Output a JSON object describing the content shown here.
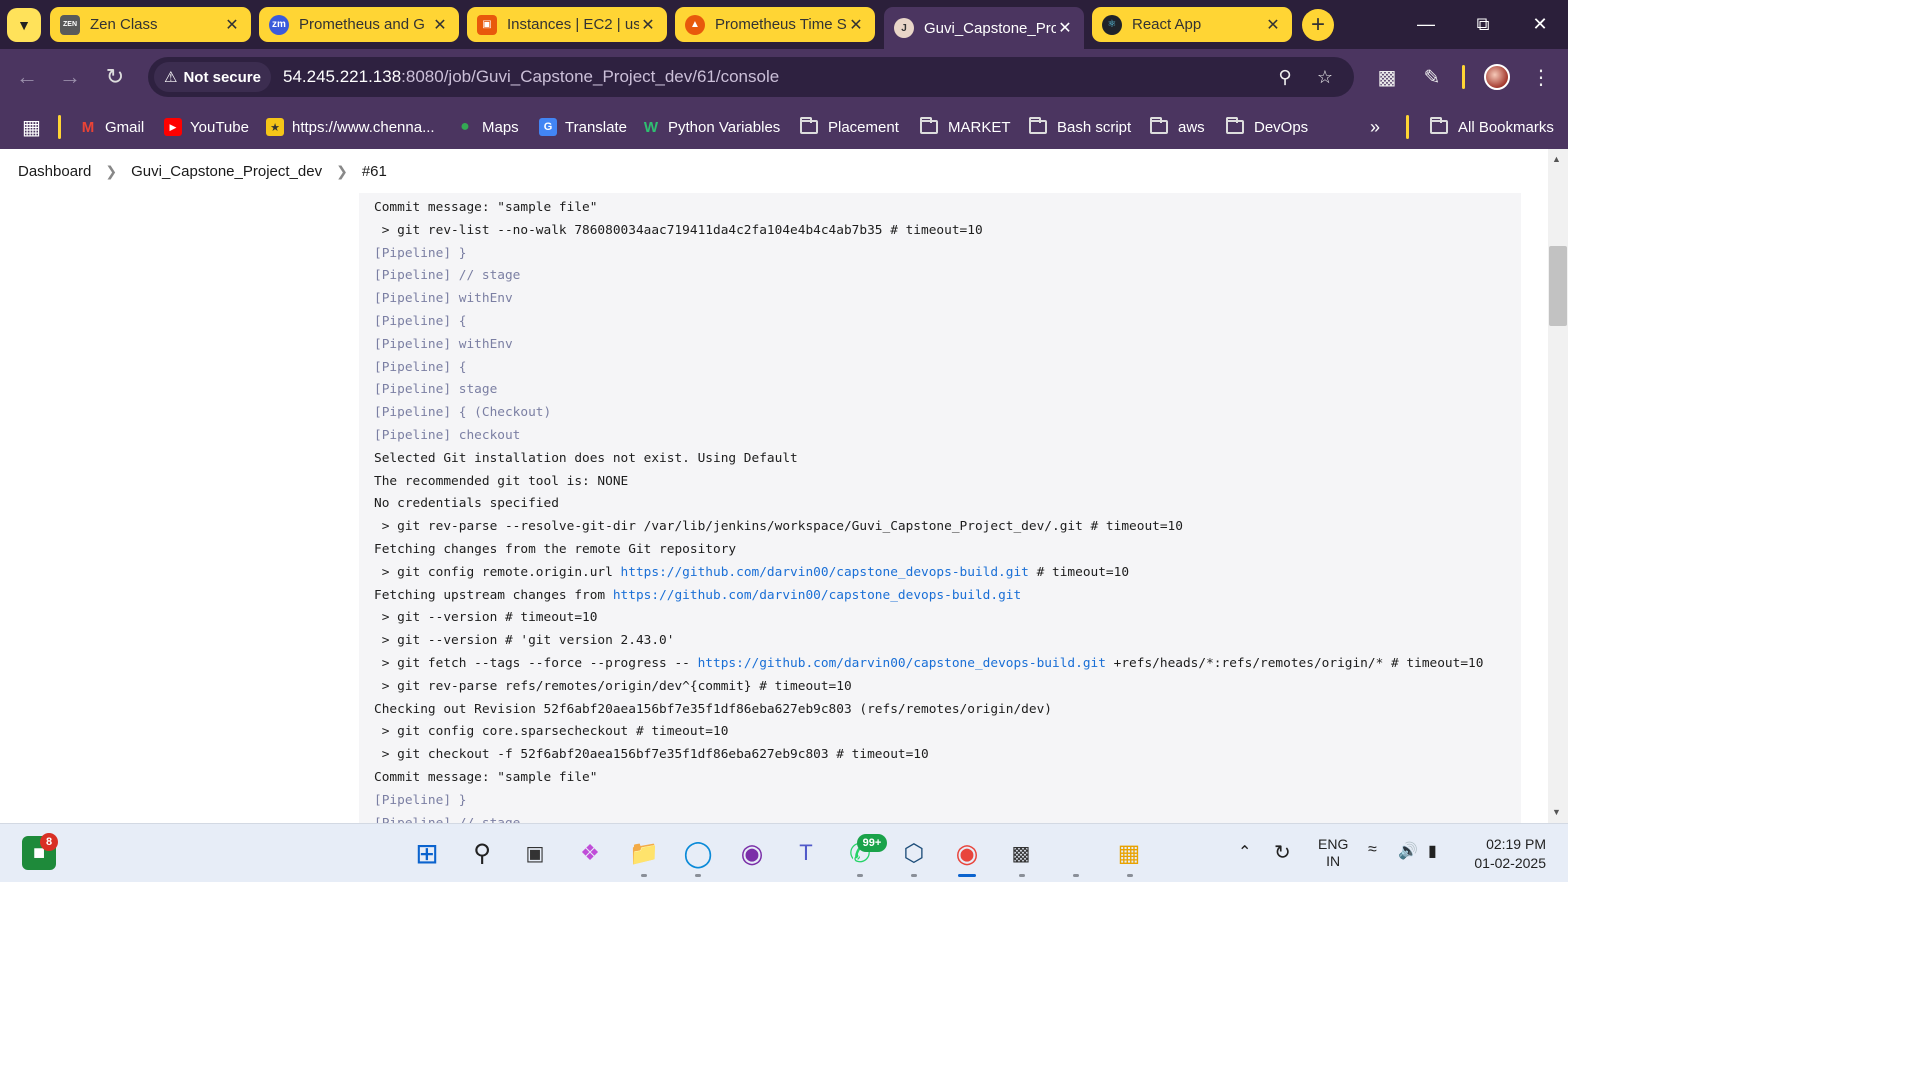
{
  "tabs": [
    {
      "title": "Zen Class",
      "icon": "zen-class-favicon"
    },
    {
      "title": "Prometheus and G",
      "icon": "zoom-favicon"
    },
    {
      "title": "Instances | EC2 | us",
      "icon": "aws-favicon"
    },
    {
      "title": "Prometheus Time S",
      "icon": "prometheus-favicon"
    },
    {
      "title": "Guvi_Capstone_Pro",
      "icon": "jenkins-favicon",
      "active": true
    },
    {
      "title": "React App",
      "icon": "react-favicon"
    }
  ],
  "omnibox": {
    "security_label": "Not secure",
    "url_host": "54.245.221.138",
    "url_rest": ":8080/job/Guvi_Capstone_Project_dev/61/console"
  },
  "bookmarks": {
    "gmail": "Gmail",
    "youtube": "YouTube",
    "chennai": "https://www.chenna...",
    "maps": "Maps",
    "translate": "Translate",
    "python": "Python Variables",
    "placement": "Placement",
    "market": "MARKET",
    "bash": "Bash script",
    "aws": "aws",
    "devops": "DevOps",
    "all": "All Bookmarks"
  },
  "breadcrumb": {
    "dashboard": "Dashboard",
    "job": "Guvi_Capstone_Project_dev",
    "build": "#61"
  },
  "console": {
    "lines": [
      {
        "text": "Commit message: \"sample file\"",
        "kind": "plain"
      },
      {
        "text": " > git rev-list --no-walk 786080034aac719411da4c2fa104e4b4c4ab7b35 # timeout=10",
        "kind": "plain"
      },
      {
        "text": "[Pipeline] }",
        "kind": "pipe"
      },
      {
        "text": "[Pipeline] // stage",
        "kind": "pipe"
      },
      {
        "text": "[Pipeline] withEnv",
        "kind": "pipe"
      },
      {
        "text": "[Pipeline] {",
        "kind": "pipe"
      },
      {
        "text": "[Pipeline] withEnv",
        "kind": "pipe"
      },
      {
        "text": "[Pipeline] {",
        "kind": "pipe"
      },
      {
        "text": "[Pipeline] stage",
        "kind": "pipe"
      },
      {
        "text": "[Pipeline] { (Checkout)",
        "kind": "pipe"
      },
      {
        "text": "[Pipeline] checkout",
        "kind": "pipe"
      },
      {
        "text": "Selected Git installation does not exist. Using Default",
        "kind": "plain"
      },
      {
        "text": "The recommended git tool is: NONE",
        "kind": "plain"
      },
      {
        "text": "No credentials specified",
        "kind": "plain"
      },
      {
        "text": " > git rev-parse --resolve-git-dir /var/lib/jenkins/workspace/Guvi_Capstone_Project_dev/.git # timeout=10",
        "kind": "plain"
      },
      {
        "text": "Fetching changes from the remote Git repository",
        "kind": "plain"
      },
      {
        "pre": " > git config remote.origin.url ",
        "link": "https://github.com/darvin00/capstone_devops-build.git",
        "post": " # timeout=10",
        "kind": "link"
      },
      {
        "pre": "Fetching upstream changes from ",
        "link": "https://github.com/darvin00/capstone_devops-build.git",
        "post": "",
        "kind": "link"
      },
      {
        "text": " > git --version # timeout=10",
        "kind": "plain"
      },
      {
        "text": " > git --version # 'git version 2.43.0'",
        "kind": "plain"
      },
      {
        "pre": " > git fetch --tags --force --progress -- ",
        "link": "https://github.com/darvin00/capstone_devops-build.git",
        "post": " +refs/heads/*:refs/remotes/origin/* # timeout=10",
        "kind": "link"
      },
      {
        "text": " > git rev-parse refs/remotes/origin/dev^{commit} # timeout=10",
        "kind": "plain"
      },
      {
        "text": "Checking out Revision 52f6abf20aea156bf7e35f1df86eba627eb9c803 (refs/remotes/origin/dev)",
        "kind": "plain"
      },
      {
        "text": " > git config core.sparsecheckout # timeout=10",
        "kind": "plain"
      },
      {
        "text": " > git checkout -f 52f6abf20aea156bf7e35f1df86eba627eb9c803 # timeout=10",
        "kind": "plain"
      },
      {
        "text": "Commit message: \"sample file\"",
        "kind": "plain"
      },
      {
        "text": "[Pipeline] }",
        "kind": "pipe"
      },
      {
        "text": "[Pipeline] // stage",
        "kind": "pipe"
      }
    ]
  },
  "taskbar": {
    "widgets_badge": "8",
    "whatsapp_badge": "99+",
    "lang_top": "ENG",
    "lang_bottom": "IN",
    "time": "02:19 PM",
    "date": "01-02-2025"
  },
  "colors": {
    "chrome_theme": "#4b3560",
    "tab_strip": "#2b1f3a",
    "tab_yellow": "#ffd534",
    "link": "#1a6fd6",
    "pipeline_text": "#7b7fa3"
  }
}
